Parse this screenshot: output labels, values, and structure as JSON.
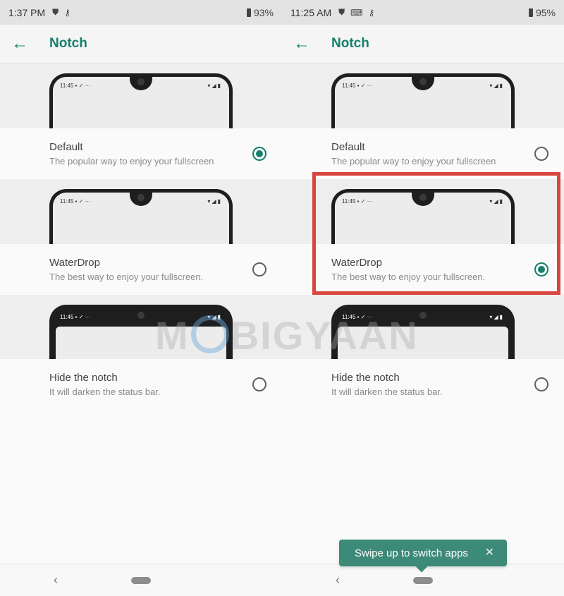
{
  "left": {
    "status": {
      "time": "1:37 PM",
      "battery": "93%"
    },
    "title": "Notch",
    "options": [
      {
        "title": "Default",
        "desc": "The popular way to enjoy your fullscreen",
        "checked": true
      },
      {
        "title": "WaterDrop",
        "desc": "The best way to enjoy your fullscreen.",
        "checked": false
      },
      {
        "title": "Hide the notch",
        "desc": "It will darken the status bar.",
        "checked": false
      }
    ]
  },
  "right": {
    "status": {
      "time": "11:25 AM",
      "battery": "95%"
    },
    "title": "Notch",
    "options": [
      {
        "title": "Default",
        "desc": "The popular way to enjoy your fullscreen",
        "checked": false
      },
      {
        "title": "WaterDrop",
        "desc": "The best way to enjoy your fullscreen.",
        "checked": true
      },
      {
        "title": "Hide the notch",
        "desc": "It will darken the status bar.",
        "checked": false
      }
    ],
    "toast": "Swipe up to switch apps"
  },
  "preview_time": "11:45",
  "watermark": "MOBIGYAAN",
  "colors": {
    "accent": "#14806d",
    "highlight": "#d9463e",
    "toast": "#3d8a78"
  },
  "icons": {
    "back": "arrow-left-icon",
    "radio": "radio-icon",
    "close": "close-icon",
    "nav_back": "chevron-left-icon",
    "nav_home": "home-pill-icon"
  }
}
